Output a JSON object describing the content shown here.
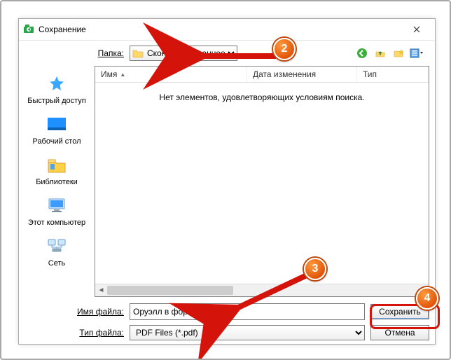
{
  "window": {
    "title": "Сохранение"
  },
  "folder_row": {
    "label": "Папка:",
    "current": "Сконвертированное"
  },
  "columns": {
    "name": "Имя",
    "date": "Дата изменения",
    "type": "Тип"
  },
  "empty_msg": "Нет элементов, удовлетворяющих условиям поиска.",
  "places": {
    "quick": "Быстрый доступ",
    "desktop": "Рабочий стол",
    "libs": "Библиотеки",
    "pc": "Этот компьютер",
    "net": "Сеть"
  },
  "filename_row": {
    "label": "Имя файла:",
    "value": "Оруэлл в формате PDF"
  },
  "filetype_row": {
    "label": "Тип файла:",
    "value": "PDF Files (*.pdf)"
  },
  "buttons": {
    "save": "Сохранить",
    "cancel": "Отмена"
  },
  "annotations": {
    "b2": "2",
    "b3": "3",
    "b4": "4"
  }
}
